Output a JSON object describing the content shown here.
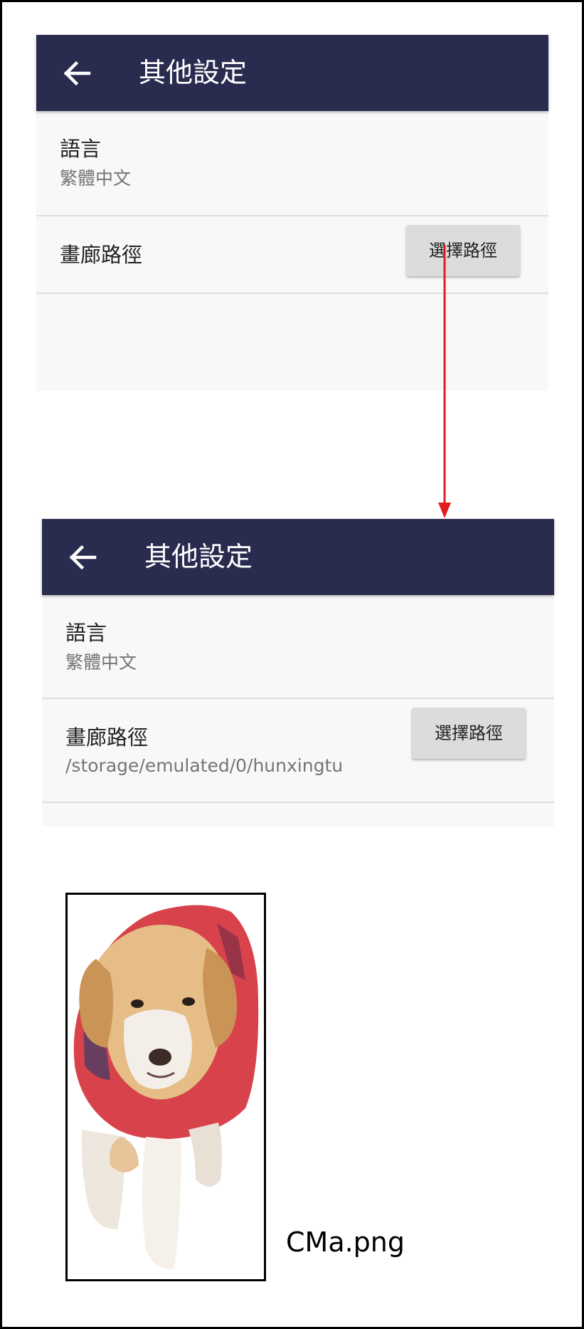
{
  "screens": [
    {
      "appbar": {
        "back_icon": "arrow-left-icon",
        "title": "其他設定"
      },
      "language": {
        "title": "語言",
        "summary": "繁體中文"
      },
      "gallery_path": {
        "title": "畫廊路徑",
        "button_label": "選擇路徑"
      }
    },
    {
      "appbar": {
        "back_icon": "arrow-left-icon",
        "title": "其他設定"
      },
      "language": {
        "title": "語言",
        "summary": "繁體中文"
      },
      "gallery_path": {
        "title": "畫廊路徑",
        "summary": "/storage/emulated/0/hunxingtu",
        "button_label": "選擇路徑"
      }
    }
  ],
  "arrow_color": "#e41a1c",
  "image_caption": "CMa.png"
}
